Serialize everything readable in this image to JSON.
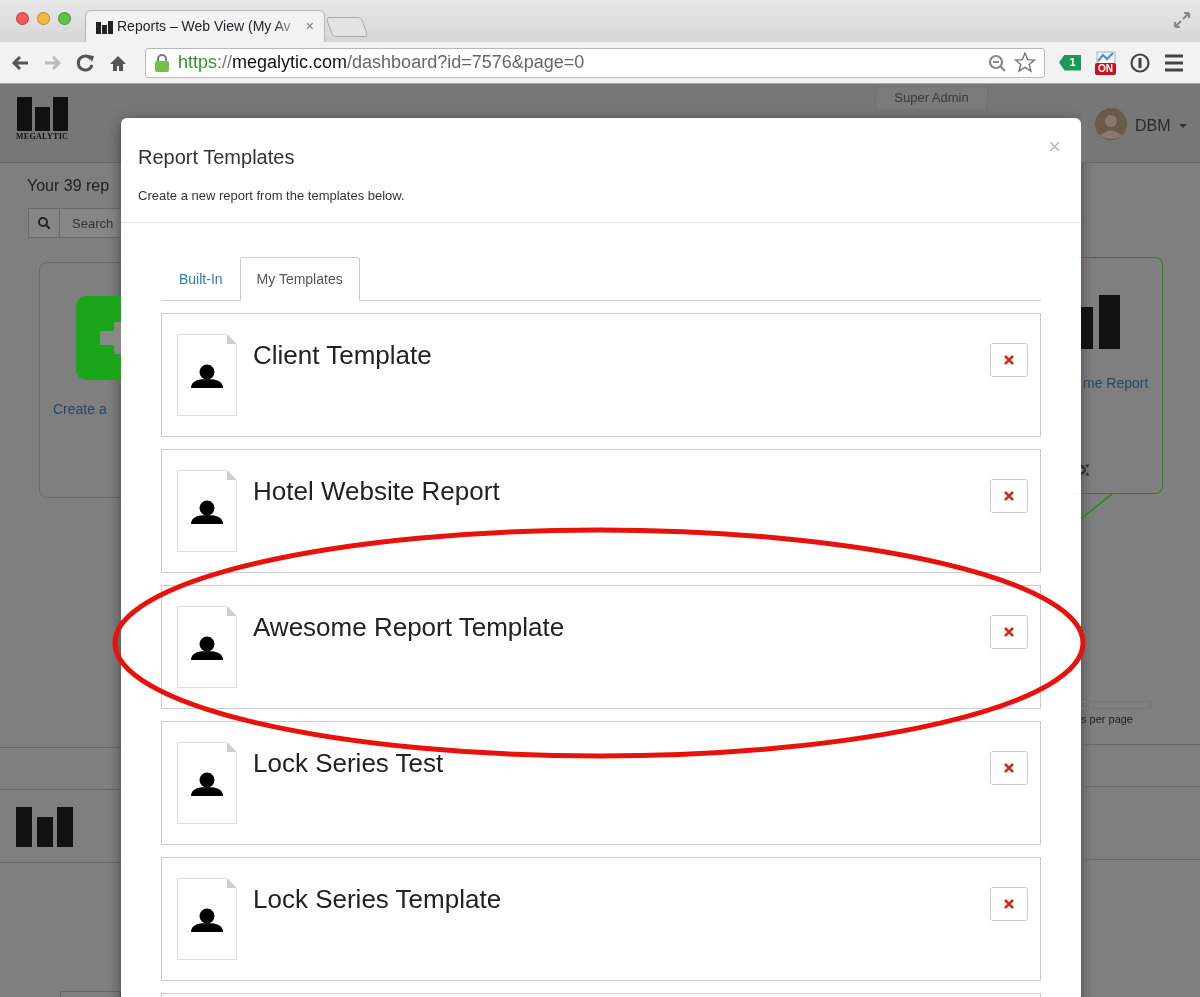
{
  "browser": {
    "tab": {
      "title": "Reports – Web View (My Av",
      "close": "×"
    },
    "address": {
      "scheme": "https",
      "separator": "://",
      "host": "megalytic.com",
      "path": "/dashboard?id=7576&page=0"
    },
    "extensions": [
      {
        "kind": "tag",
        "text": "1"
      },
      {
        "kind": "switch",
        "text": "ON"
      },
      {
        "kind": "password"
      }
    ]
  },
  "app": {
    "logo_text": "MEGALYTIC",
    "admin_button": "Super Admin",
    "user": "DBM",
    "heading": "Your 39 rep",
    "search": {
      "placeholder": "Search"
    },
    "create_link": "Create a",
    "report_link": "me Report",
    "per_page": "s per page"
  },
  "modal": {
    "title": "Report Templates",
    "subtitle": "Create a new report from the templates below.",
    "close": "×",
    "tabs": [
      {
        "label": "Built-In",
        "selected": false
      },
      {
        "label": "My Templates",
        "selected": true
      }
    ],
    "templates": [
      {
        "name": "Client Template",
        "highlighted": false
      },
      {
        "name": "Hotel Website Report",
        "highlighted": false
      },
      {
        "name": "Awesome Report Template",
        "highlighted": true
      },
      {
        "name": "Lock Series Test",
        "highlighted": false
      },
      {
        "name": "Lock Series Template",
        "highlighted": false
      }
    ]
  }
}
